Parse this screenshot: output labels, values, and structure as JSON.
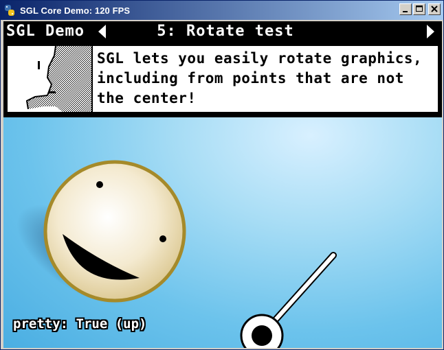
{
  "window": {
    "title": "SGL Core Demo: 120 FPS",
    "buttons": {
      "minimize": "_",
      "maximize": "□",
      "close": "×"
    }
  },
  "topbar": {
    "app_title": "SGL Demo",
    "scene_title": "5: Rotate test"
  },
  "dialog": {
    "lines": [
      "SGL lets you easily rotate graphics,",
      "including from points that are not",
      "the center!"
    ]
  },
  "status": {
    "text": "pretty: True (up)"
  },
  "colors": {
    "titlebar_start": "#0a246a",
    "titlebar_end": "#a6caf0",
    "background_sky": "#6cc3ec",
    "ball_rim": "#a58a2a"
  },
  "icons": {
    "app": "python-snake-icon",
    "prev": "triangle-left-icon",
    "next": "triangle-right-icon"
  }
}
